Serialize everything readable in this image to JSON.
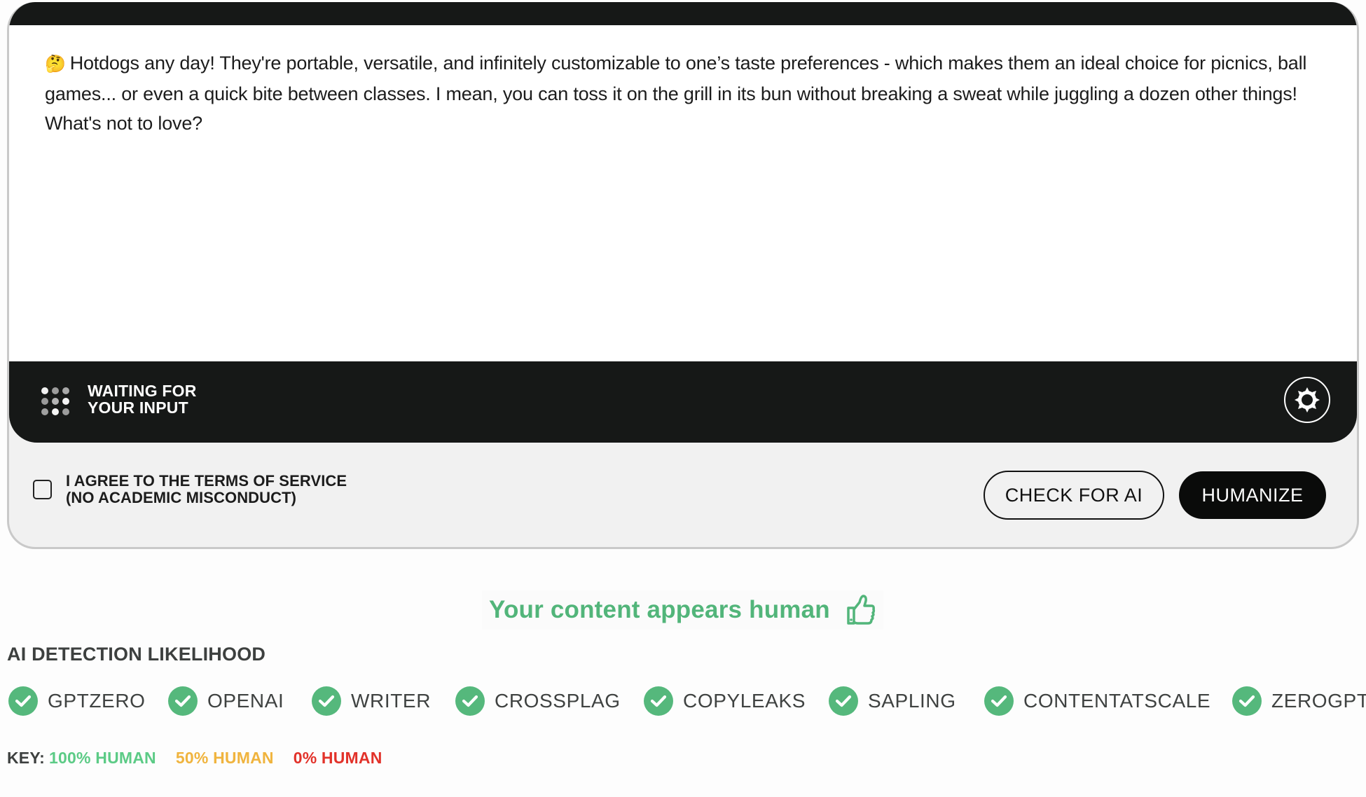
{
  "editor": {
    "emoji": "🤔",
    "text": "Hotdogs any day! They're portable, versatile, and infinitely customizable to one’s taste preferences - which makes them an ideal choice for picnics, ball games... or even a quick bite between classes. I mean, you can toss it on the grill in its bun without breaking a sweat while juggling a dozen other things! What's not to love?"
  },
  "status": {
    "line1": "WAITING FOR",
    "line2": "YOUR INPUT",
    "icon": "loading-dots-icon",
    "settings_icon": "gear-icon"
  },
  "footer": {
    "agree_line1": "I AGREE TO THE TERMS OF SERVICE",
    "agree_line2": "(NO ACADEMIC MISCONDUCT)",
    "agree_checked": false,
    "check_button": "CHECK FOR AI",
    "humanize_button": "HUMANIZE"
  },
  "result": {
    "message": "Your content appears human",
    "icon": "thumbs-up-icon",
    "color": "#52b57a"
  },
  "detection": {
    "title": "AI DETECTION LIKELIHOOD",
    "detectors": [
      {
        "name": "GPTZERO",
        "status": "human"
      },
      {
        "name": "OPENAI",
        "status": "human"
      },
      {
        "name": "WRITER",
        "status": "human"
      },
      {
        "name": "CROSSPLAG",
        "status": "human"
      },
      {
        "name": "COPYLEAKS",
        "status": "human"
      },
      {
        "name": "SAPLING",
        "status": "human"
      },
      {
        "name": "CONTENTATSCALE",
        "status": "human"
      },
      {
        "name": "ZEROGPT",
        "status": "human"
      }
    ]
  },
  "key": {
    "label": "KEY:",
    "items": [
      {
        "text": "100% HUMAN",
        "color": "#5ccb86"
      },
      {
        "text": "50% HUMAN",
        "color": "#f0b43e"
      },
      {
        "text": "0% HUMAN",
        "color": "#e2322a"
      }
    ]
  }
}
